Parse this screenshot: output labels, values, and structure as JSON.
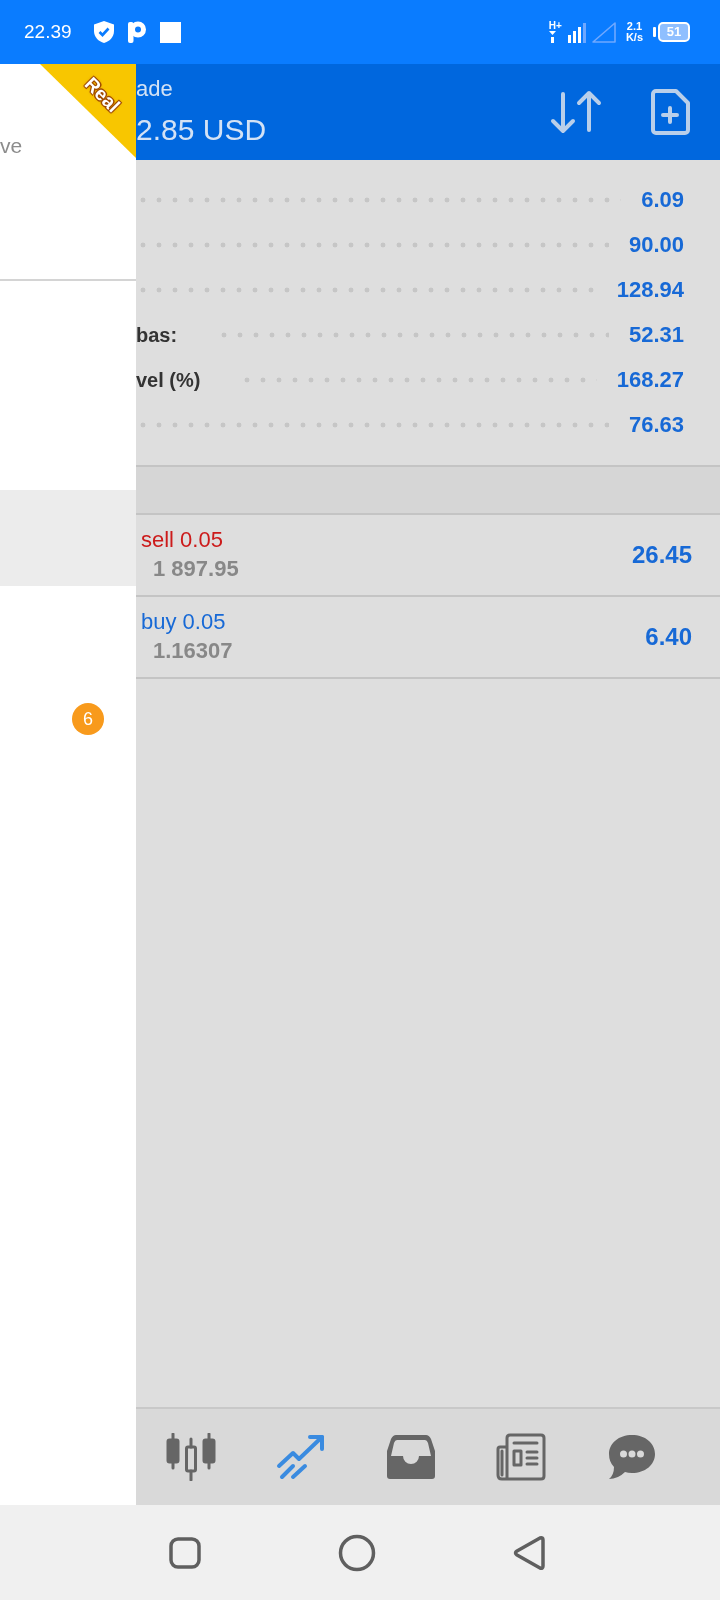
{
  "status_bar": {
    "time": "22.39",
    "network_type": "H+",
    "speed_value": "2.1",
    "speed_unit": "K/s",
    "battery": "51"
  },
  "drawer": {
    "ribbon": "Real",
    "subtitle": "ve",
    "items": [
      {
        "selected": true
      },
      {
        "selected": false,
        "badge": "6"
      }
    ]
  },
  "header": {
    "title": "ade",
    "balance": "2.85 USD"
  },
  "account_rows": [
    {
      "value": "6.09"
    },
    {
      "value": "90.00"
    },
    {
      "value": "128.94"
    },
    {
      "label": "bas:",
      "value": "52.31"
    },
    {
      "label": "vel (%)",
      "value": "168.27"
    },
    {
      "value": "76.63"
    }
  ],
  "orders": [
    {
      "kind": "sell",
      "type": "sell 0.05",
      "price": "1 897.95",
      "profit": "26.45"
    },
    {
      "kind": "buy",
      "type": "buy 0.05",
      "price": "1.16307",
      "profit": "6.40"
    }
  ],
  "bottom_nav": [
    {
      "selected": false
    },
    {
      "selected": true
    },
    {
      "selected": false
    },
    {
      "selected": false
    },
    {
      "selected": false
    }
  ]
}
